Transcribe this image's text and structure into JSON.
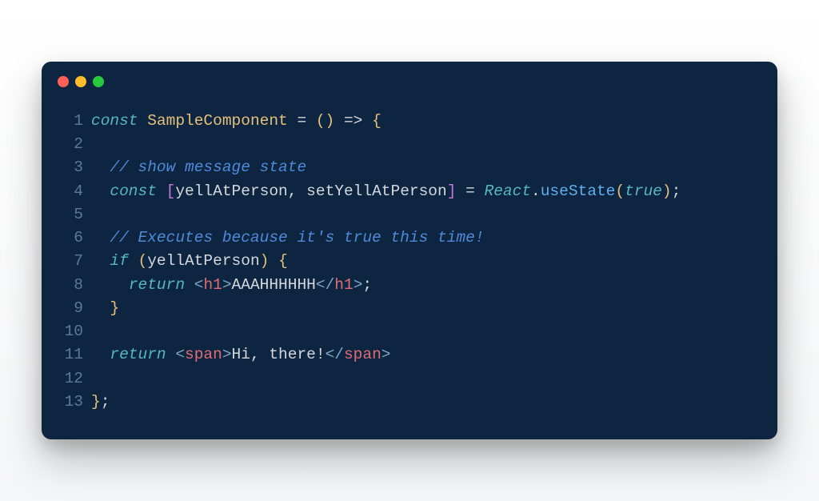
{
  "window": {
    "controls": [
      "close",
      "minimize",
      "maximize"
    ]
  },
  "code": {
    "lines": [
      {
        "num": "1",
        "tokens": [
          {
            "t": "const",
            "c": "tok-keyword"
          },
          {
            "t": " ",
            "c": "tok-default"
          },
          {
            "t": "SampleComponent",
            "c": "tok-identifier"
          },
          {
            "t": " ",
            "c": "tok-default"
          },
          {
            "t": "=",
            "c": "tok-operator"
          },
          {
            "t": " ",
            "c": "tok-default"
          },
          {
            "t": "()",
            "c": "tok-punct"
          },
          {
            "t": " ",
            "c": "tok-default"
          },
          {
            "t": "=>",
            "c": "tok-operator"
          },
          {
            "t": " ",
            "c": "tok-default"
          },
          {
            "t": "{",
            "c": "tok-punct"
          }
        ]
      },
      {
        "num": "2",
        "tokens": []
      },
      {
        "num": "3",
        "tokens": [
          {
            "t": "  ",
            "c": "tok-default"
          },
          {
            "t": "// show message state",
            "c": "tok-comment"
          }
        ]
      },
      {
        "num": "4",
        "tokens": [
          {
            "t": "  ",
            "c": "tok-default"
          },
          {
            "t": "const",
            "c": "tok-keyword"
          },
          {
            "t": " ",
            "c": "tok-default"
          },
          {
            "t": "[",
            "c": "tok-bracket"
          },
          {
            "t": "yellAtPerson",
            "c": "tok-default"
          },
          {
            "t": ",",
            "c": "tok-default"
          },
          {
            "t": " ",
            "c": "tok-default"
          },
          {
            "t": "setYellAtPerson",
            "c": "tok-default"
          },
          {
            "t": "]",
            "c": "tok-bracket"
          },
          {
            "t": " ",
            "c": "tok-default"
          },
          {
            "t": "=",
            "c": "tok-operator"
          },
          {
            "t": " ",
            "c": "tok-default"
          },
          {
            "t": "React",
            "c": "tok-object"
          },
          {
            "t": ".",
            "c": "tok-default"
          },
          {
            "t": "useState",
            "c": "tok-method"
          },
          {
            "t": "(",
            "c": "tok-punct"
          },
          {
            "t": "true",
            "c": "tok-boolean"
          },
          {
            "t": ")",
            "c": "tok-punct"
          },
          {
            "t": ";",
            "c": "tok-default"
          }
        ]
      },
      {
        "num": "5",
        "tokens": []
      },
      {
        "num": "6",
        "tokens": [
          {
            "t": "  ",
            "c": "tok-default"
          },
          {
            "t": "// Executes because it's true this time!",
            "c": "tok-comment"
          }
        ]
      },
      {
        "num": "7",
        "tokens": [
          {
            "t": "  ",
            "c": "tok-default"
          },
          {
            "t": "if",
            "c": "tok-keyword"
          },
          {
            "t": " ",
            "c": "tok-default"
          },
          {
            "t": "(",
            "c": "tok-punct"
          },
          {
            "t": "yellAtPerson",
            "c": "tok-default"
          },
          {
            "t": ")",
            "c": "tok-punct"
          },
          {
            "t": " ",
            "c": "tok-default"
          },
          {
            "t": "{",
            "c": "tok-punct"
          }
        ]
      },
      {
        "num": "8",
        "tokens": [
          {
            "t": "    ",
            "c": "tok-default"
          },
          {
            "t": "return",
            "c": "tok-keyword"
          },
          {
            "t": " ",
            "c": "tok-default"
          },
          {
            "t": "<",
            "c": "tok-tag-bracket"
          },
          {
            "t": "h1",
            "c": "tok-tag-name"
          },
          {
            "t": ">",
            "c": "tok-tag-bracket"
          },
          {
            "t": "AAAHHHHHH",
            "c": "tok-text"
          },
          {
            "t": "</",
            "c": "tok-tag-bracket"
          },
          {
            "t": "h1",
            "c": "tok-tag-name"
          },
          {
            "t": ">",
            "c": "tok-tag-bracket"
          },
          {
            "t": ";",
            "c": "tok-default"
          }
        ]
      },
      {
        "num": "9",
        "tokens": [
          {
            "t": "  ",
            "c": "tok-default"
          },
          {
            "t": "}",
            "c": "tok-punct"
          }
        ]
      },
      {
        "num": "10",
        "tokens": []
      },
      {
        "num": "11",
        "tokens": [
          {
            "t": "  ",
            "c": "tok-default"
          },
          {
            "t": "return",
            "c": "tok-keyword"
          },
          {
            "t": " ",
            "c": "tok-default"
          },
          {
            "t": "<",
            "c": "tok-tag-bracket"
          },
          {
            "t": "span",
            "c": "tok-tag-name"
          },
          {
            "t": ">",
            "c": "tok-tag-bracket"
          },
          {
            "t": "Hi, there!",
            "c": "tok-text"
          },
          {
            "t": "</",
            "c": "tok-tag-bracket"
          },
          {
            "t": "span",
            "c": "tok-tag-name"
          },
          {
            "t": ">",
            "c": "tok-tag-bracket"
          }
        ]
      },
      {
        "num": "12",
        "tokens": []
      },
      {
        "num": "13",
        "tokens": [
          {
            "t": "}",
            "c": "tok-punct"
          },
          {
            "t": ";",
            "c": "tok-default"
          }
        ]
      }
    ]
  }
}
